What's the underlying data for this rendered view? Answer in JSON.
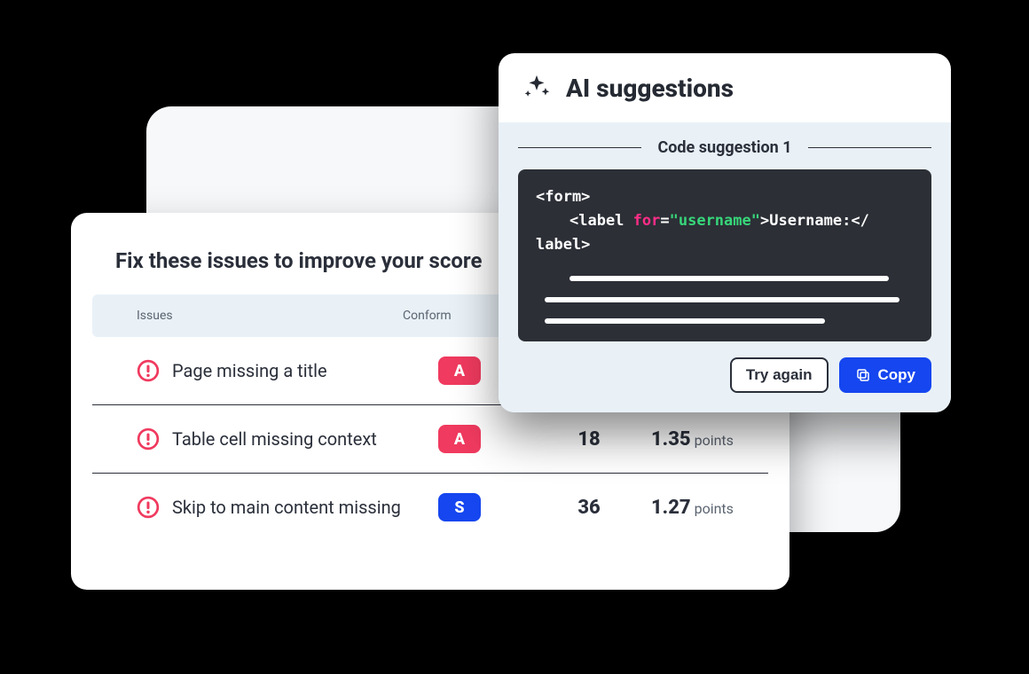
{
  "issues_panel": {
    "title": "Fix these issues to improve your score",
    "columns": {
      "issue": "Issues",
      "conformance": "Conform"
    },
    "rows": [
      {
        "label": "Page missing a title",
        "badge": "A",
        "badge_color": "red"
      },
      {
        "label": "Table cell missing context",
        "badge": "A",
        "badge_color": "red",
        "count": "18",
        "score": "1.35",
        "score_unit": "points"
      },
      {
        "label": "Skip to main content missing",
        "badge": "S",
        "badge_color": "blue",
        "count": "36",
        "score": "1.27",
        "score_unit": "points"
      }
    ]
  },
  "ai_popover": {
    "title": "AI suggestions",
    "suggestion_label": "Code suggestion 1",
    "code_tokens": {
      "line1": "<form>",
      "line2_pre": "<label ",
      "line2_attr": "for",
      "line2_eq": "=",
      "line2_val": "\"username\"",
      "line2_post": ">Username:</",
      "line3": "label>"
    },
    "buttons": {
      "retry": "Try again",
      "copy": "Copy"
    }
  }
}
